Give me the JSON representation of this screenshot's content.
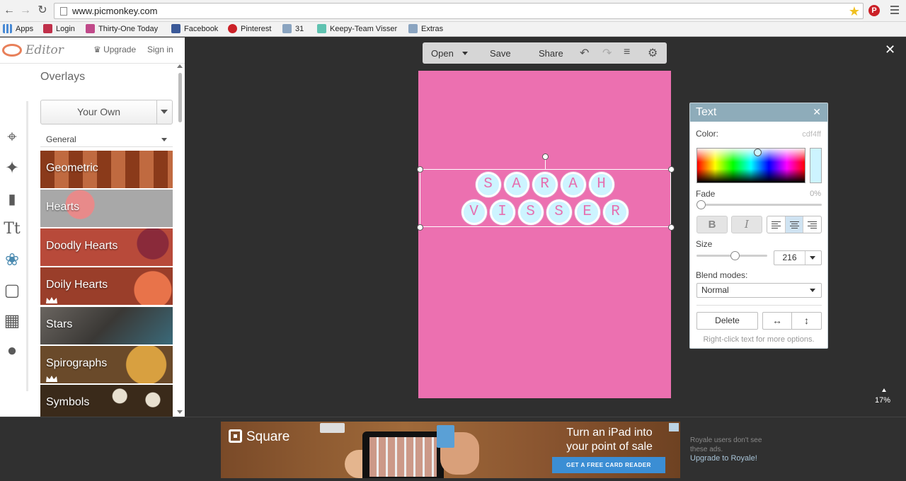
{
  "browser": {
    "url": "www.picmonkey.com",
    "bookmarks": [
      {
        "label": "Apps",
        "icon": "apps-grid-icon",
        "color": "#4a8ad4"
      },
      {
        "label": "Login",
        "icon": "login-favicon",
        "color": "#c0304a"
      },
      {
        "label": "Thirty-One Today",
        "icon": "thirty-one-favicon",
        "color": "#c04a8a"
      },
      {
        "label": "Facebook",
        "icon": "facebook-icon",
        "color": "#3b5998"
      },
      {
        "label": "Pinterest",
        "icon": "pinterest-icon",
        "color": "#cb2027"
      },
      {
        "label": "31",
        "icon": "folder-icon",
        "color": "#8aa4c0"
      },
      {
        "label": "Keepy-Team Visser",
        "icon": "keepy-favicon",
        "color": "#5fc2b0"
      },
      {
        "label": "Extras",
        "icon": "folder-icon",
        "color": "#8aa4c0"
      }
    ]
  },
  "editor": {
    "brand": "Editor",
    "upgrade": "Upgrade",
    "sign_in": "Sign in",
    "panel_title": "Overlays",
    "your_own": "Your Own",
    "category": "General",
    "tools": [
      "crop-icon",
      "magic-wand-icon",
      "lipstick-icon",
      "text-tool-icon",
      "butterfly-icon",
      "frame-icon",
      "texture-icon",
      "apple-icon"
    ],
    "overlays": [
      {
        "label": "Geometric",
        "bg": "#9a4a2a",
        "royale": false
      },
      {
        "label": "Hearts",
        "bg": "#a8a8a8",
        "royale": false
      },
      {
        "label": "Doodly Hearts",
        "bg": "#b84a3a",
        "royale": false
      },
      {
        "label": "Doily Hearts",
        "bg": "#b2563a",
        "royale": true
      },
      {
        "label": "Stars",
        "bg": "#5a5550",
        "royale": false
      },
      {
        "label": "Spirographs",
        "bg": "#a87a2a",
        "royale": true
      },
      {
        "label": "Symbols",
        "bg": "#3a2a1a",
        "royale": false
      }
    ]
  },
  "topmenu": {
    "open": "Open",
    "save": "Save",
    "share": "Share"
  },
  "canvas": {
    "background": "#ec70b0",
    "row1": [
      "S",
      "A",
      "R",
      "A",
      "H"
    ],
    "row2": [
      "V",
      "I",
      "S",
      "S",
      "E",
      "R"
    ]
  },
  "text_panel": {
    "title": "Text",
    "color_label": "Color:",
    "color_value": "cdf4ff",
    "fade_label": "Fade",
    "fade_value": "0%",
    "fade_level": 0,
    "bold": "B",
    "italic": "I",
    "size_label": "Size",
    "size_value": "216",
    "blend_label": "Blend modes:",
    "blend_value": "Normal",
    "delete": "Delete",
    "hint": "Right-click text for more options."
  },
  "zoom": "17%",
  "ad": {
    "brand": "Square",
    "headline": "Turn an iPad into your point of sale",
    "cta": "GET A FREE CARD READER",
    "royale_note": "Royale users don't see these ads.",
    "royale_link": "Upgrade to Royale!"
  }
}
